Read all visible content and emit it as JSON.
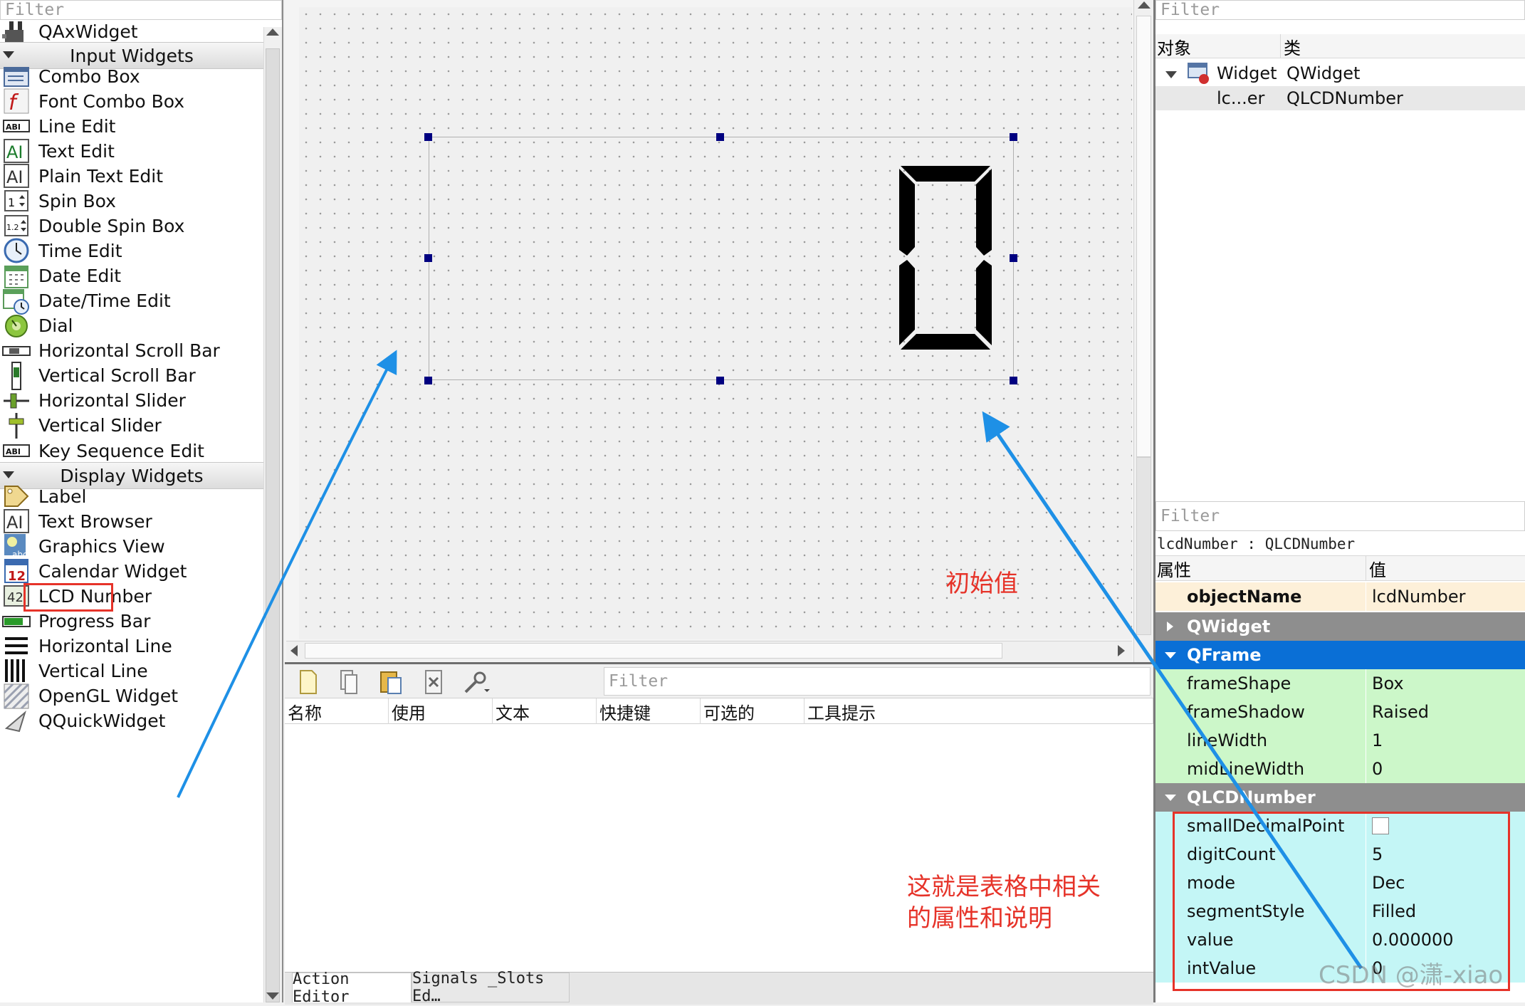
{
  "widget_box": {
    "filter_placeholder": "Filter",
    "top_item": {
      "label": "QAxWidget",
      "icon": "activex-widget-icon"
    },
    "categories": {
      "input": "Input Widgets",
      "display": "Display Widgets"
    },
    "input_items": [
      {
        "label": "Combo Box",
        "icon": "combo-box-icon"
      },
      {
        "label": "Font Combo Box",
        "icon": "font-combo-box-icon"
      },
      {
        "label": "Line Edit",
        "icon": "line-edit-icon"
      },
      {
        "label": "Text Edit",
        "icon": "text-edit-icon"
      },
      {
        "label": "Plain Text Edit",
        "icon": "plain-text-edit-icon"
      },
      {
        "label": "Spin Box",
        "icon": "spin-box-icon"
      },
      {
        "label": "Double Spin Box",
        "icon": "double-spin-box-icon"
      },
      {
        "label": "Time Edit",
        "icon": "clock-icon"
      },
      {
        "label": "Date Edit",
        "icon": "calendar-icon"
      },
      {
        "label": "Date/Time Edit",
        "icon": "datetime-icon"
      },
      {
        "label": "Dial",
        "icon": "dial-icon"
      },
      {
        "label": "Horizontal Scroll Bar",
        "icon": "horizontal-scrollbar-icon"
      },
      {
        "label": "Vertical Scroll Bar",
        "icon": "vertical-scrollbar-icon"
      },
      {
        "label": "Horizontal Slider",
        "icon": "horizontal-slider-icon"
      },
      {
        "label": "Vertical Slider",
        "icon": "vertical-slider-icon"
      },
      {
        "label": "Key Sequence Edit",
        "icon": "key-sequence-icon"
      }
    ],
    "display_items": [
      {
        "label": "Label",
        "icon": "label-tag-icon"
      },
      {
        "label": "Text Browser",
        "icon": "text-browser-icon"
      },
      {
        "label": "Graphics View",
        "icon": "graphics-view-icon"
      },
      {
        "label": "Calendar Widget",
        "icon": "calendar-widget-icon"
      },
      {
        "label": "LCD Number",
        "icon": "lcd-number-icon"
      },
      {
        "label": "Progress Bar",
        "icon": "progress-bar-icon"
      },
      {
        "label": "Horizontal Line",
        "icon": "horizontal-line-icon"
      },
      {
        "label": "Vertical Line",
        "icon": "vertical-line-icon"
      },
      {
        "label": "OpenGL Widget",
        "icon": "opengl-widget-icon"
      },
      {
        "label": "QQuickWidget",
        "icon": "quick-widget-icon"
      }
    ]
  },
  "form": {
    "lcd_display": "0"
  },
  "action_editor": {
    "filter_placeholder": "Filter",
    "columns": [
      "名称",
      "使用",
      "文本",
      "快捷键",
      "可选的",
      "工具提示"
    ],
    "tabs": [
      "Action Editor",
      "Signals _Slots Ed…"
    ]
  },
  "object_inspector": {
    "filter_placeholder": "Filter",
    "col_object": "对象",
    "col_class": "类",
    "rows": [
      {
        "object": "Widget",
        "class": "QWidget"
      },
      {
        "object": "lc...er",
        "class": "QLCDNumber"
      }
    ]
  },
  "property_editor": {
    "filter_placeholder": "Filter",
    "context": "lcdNumber : QLCDNumber",
    "col_property": "属性",
    "col_value": "值",
    "object_name": {
      "name": "objectName",
      "value": "lcdNumber"
    },
    "sections": {
      "qwidget": "QWidget",
      "qframe": "QFrame",
      "qlcdnumber": "QLCDNumber"
    },
    "qframe_props": [
      {
        "name": "frameShape",
        "value": "Box"
      },
      {
        "name": "frameShadow",
        "value": "Raised"
      },
      {
        "name": "lineWidth",
        "value": "1"
      },
      {
        "name": "midLineWidth",
        "value": "0"
      }
    ],
    "qlcd_props": [
      {
        "name": "smallDecimalPoint",
        "value": ""
      },
      {
        "name": "digitCount",
        "value": "5"
      },
      {
        "name": "mode",
        "value": "Dec"
      },
      {
        "name": "segmentStyle",
        "value": "Filled"
      },
      {
        "name": "value",
        "value": "0.000000"
      },
      {
        "name": "intValue",
        "value": "0"
      }
    ]
  },
  "annotations": {
    "initial_value": "初始值",
    "note_line1": "这就是表格中相关",
    "note_line2": "的属性和说明",
    "watermark": "CSDN @潇-xiao"
  },
  "colors": {
    "qframe_header": "#0a6fd6",
    "section_header": "#8e8e8e",
    "qframe_rows": "#ccf7c9",
    "qlcd_rows": "#c4f6f6",
    "object_name_row": "#fdf0d9",
    "annotation_red": "#e63329",
    "arrow_blue": "#1e90e6",
    "selection_handle": "#000080"
  }
}
